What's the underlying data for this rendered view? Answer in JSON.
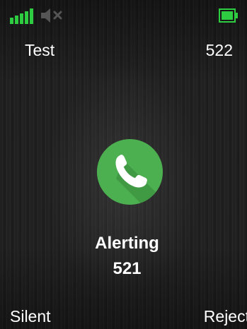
{
  "status_bar": {
    "signal_icon": "signal-bars-icon",
    "speaker_icon": "speaker-muted-icon",
    "battery_icon": "battery-full-icon",
    "accent_color": "#2ecc40"
  },
  "header": {
    "line_name": "Test",
    "own_number": "522"
  },
  "call": {
    "icon": "phone-handset-icon",
    "icon_color": "#4caf50",
    "status": "Alerting",
    "number": "521"
  },
  "softkeys": {
    "left": "Silent",
    "right": "Reject"
  }
}
